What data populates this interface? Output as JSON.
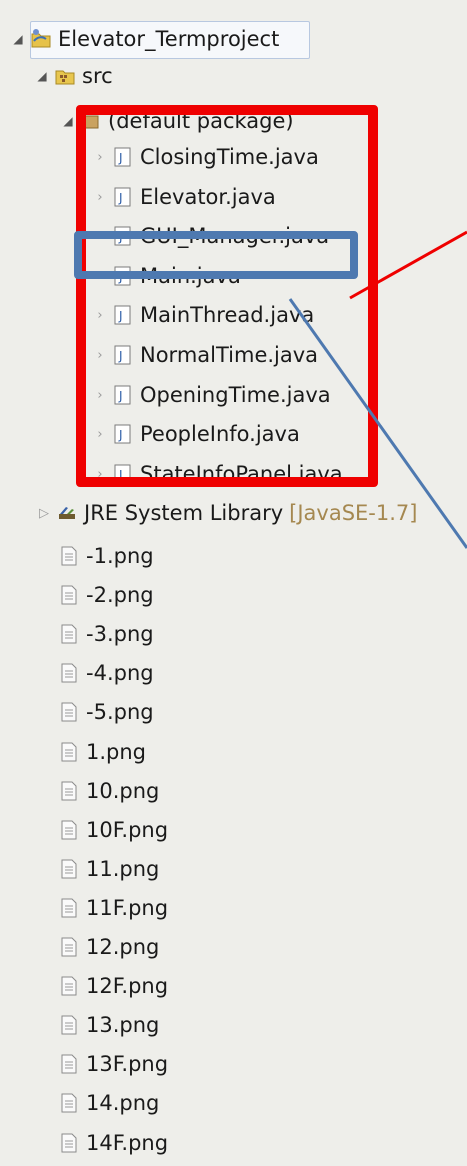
{
  "tree": {
    "project": {
      "label": "Elevator_Termproject",
      "icon": "java-project-icon"
    },
    "src": {
      "label": "src",
      "icon": "source-folder-icon"
    },
    "package": {
      "label": "(default package)",
      "icon": "package-icon"
    },
    "java_files": [
      {
        "label": "ClosingTime.java"
      },
      {
        "label": "Elevator.java"
      },
      {
        "label": "GUI_Manager.java"
      },
      {
        "label": "Main.java"
      },
      {
        "label": "MainThread.java"
      },
      {
        "label": "NormalTime.java"
      },
      {
        "label": "OpeningTime.java"
      },
      {
        "label": "PeopleInfo.java"
      },
      {
        "label": "StateInfoPanel.java"
      }
    ],
    "jre": {
      "label": "JRE System Library",
      "suffix": "[JavaSE-1.7]",
      "icon": "library-icon"
    },
    "png_files": [
      {
        "label": "-1.png"
      },
      {
        "label": "-2.png"
      },
      {
        "label": "-3.png"
      },
      {
        "label": "-4.png"
      },
      {
        "label": "-5.png"
      },
      {
        "label": "1.png"
      },
      {
        "label": "10.png"
      },
      {
        "label": "10F.png"
      },
      {
        "label": "11.png"
      },
      {
        "label": "11F.png"
      },
      {
        "label": "12.png"
      },
      {
        "label": "12F.png"
      },
      {
        "label": "13.png"
      },
      {
        "label": "13F.png"
      },
      {
        "label": "14.png"
      },
      {
        "label": "14F.png"
      }
    ]
  },
  "colors": {
    "highlight_red": "#ef0000",
    "highlight_blue": "#4e79b0",
    "background": "#eeeeea"
  }
}
